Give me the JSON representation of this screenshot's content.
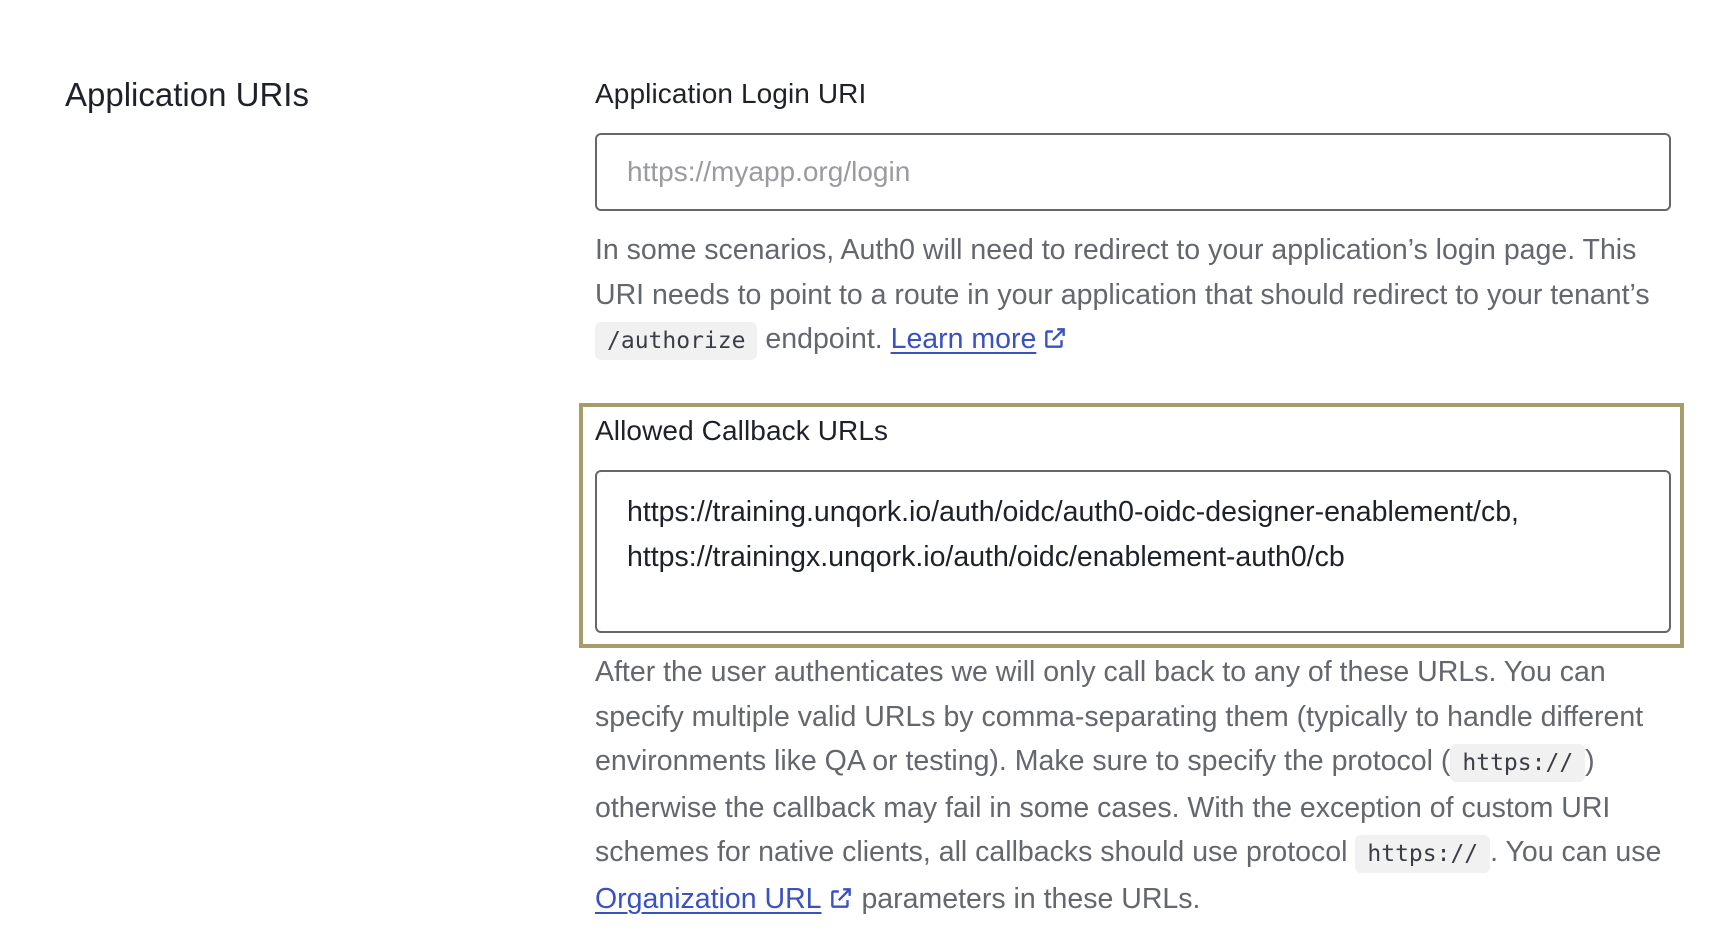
{
  "section": {
    "title": "Application URIs"
  },
  "login_uri": {
    "label": "Application Login URI",
    "placeholder": "https://myapp.org/login",
    "help_part1": "In some scenarios, Auth0 will need to redirect to your application’s login page. This URI needs to point to a route in your application that should redirect to your tenant’s ",
    "help_code": "/authorize",
    "help_part2": " endpoint. ",
    "learn_more": "Learn more"
  },
  "callback_urls": {
    "label": "Allowed Callback URLs",
    "value": "https://training.unqork.io/auth/oidc/auth0-oidc-designer-enablement/cb,\nhttps://trainingx.unqork.io/auth/oidc/enablement-auth0/cb",
    "help_part1": "After the user authenticates we will only call back to any of these URLs. You can specify multiple valid URLs by comma-separating them (typically to handle different environments like QA or testing). Make sure to specify the protocol (",
    "help_code1": "https://",
    "help_part2": ") otherwise the callback may fail in some cases. With the exception of custom URI schemes for native clients, all callbacks should use protocol ",
    "help_code2": "https://",
    "help_part3": ". You can use ",
    "org_link": "Organization URL",
    "help_part4": " parameters in these URLs."
  },
  "colors": {
    "link": "#3a51c2",
    "highlight_border": "#a79c6c",
    "help_text": "#65676e"
  },
  "icons": {
    "external_link": "external-link-icon"
  }
}
